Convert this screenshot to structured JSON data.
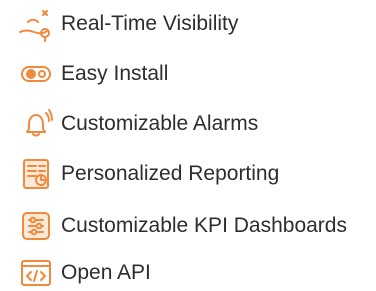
{
  "features": {
    "accent_color": "#f08a3e",
    "text_color": "#2d2d2d",
    "items": [
      {
        "label": "Real-Time Visibility",
        "icon": "route-pin-icon"
      },
      {
        "label": "Easy Install",
        "icon": "toggle-switch-icon"
      },
      {
        "label": "Customizable Alarms",
        "icon": "bell-icon"
      },
      {
        "label": "Personalized Reporting",
        "icon": "report-icon"
      },
      {
        "label": "Customizable KPI Dashboards",
        "icon": "sliders-icon"
      },
      {
        "label": "Open API",
        "icon": "code-window-icon"
      }
    ]
  }
}
